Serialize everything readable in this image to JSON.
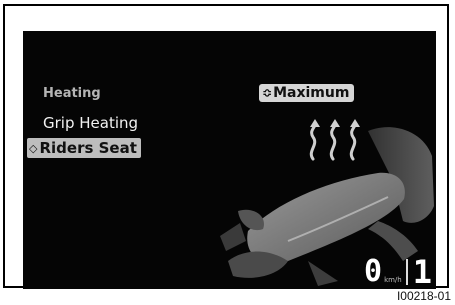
{
  "menu": {
    "title": "Heating",
    "items": [
      {
        "label": "Grip Heating",
        "selected": false
      },
      {
        "label": "Riders Seat",
        "selected": true,
        "marker": "◇"
      }
    ]
  },
  "setting": {
    "icon": "up-down-arrows-icon",
    "arrow_glyph": "≎",
    "label": "Maximum"
  },
  "status": {
    "speed": "0",
    "speed_unit": "km/h",
    "gear": "1"
  },
  "figure_code": "I00218-01",
  "colors": {
    "screen_bg": "#050505",
    "highlight_bg": "#bdbdbd",
    "text_primary": "#f2f2f2",
    "text_muted": "#b5b5b5"
  },
  "icons": [
    "heat-waves-icon",
    "motorcycle-seat-illustration"
  ]
}
